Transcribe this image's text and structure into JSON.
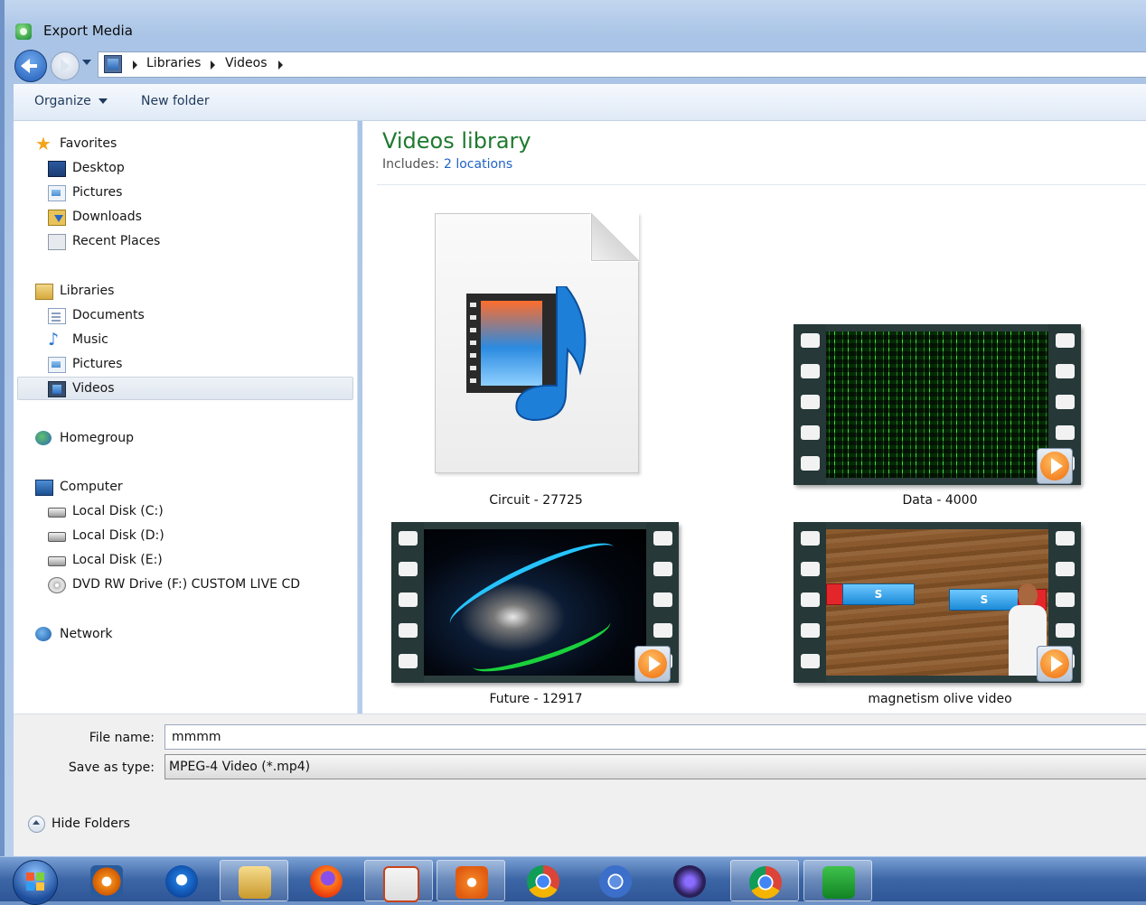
{
  "window": {
    "title": "Export Media"
  },
  "address": {
    "crumbs": [
      "Libraries",
      "Videos"
    ]
  },
  "toolbar": {
    "organize_label": "Organize",
    "new_folder_label": "New folder"
  },
  "nav": {
    "favorites": {
      "label": "Favorites",
      "items": [
        "Desktop",
        "Pictures",
        "Downloads",
        "Recent Places"
      ]
    },
    "libraries": {
      "label": "Libraries",
      "items": [
        "Documents",
        "Music",
        "Pictures",
        "Videos"
      ],
      "selected": "Videos"
    },
    "homegroup": {
      "label": "Homegroup"
    },
    "computer": {
      "label": "Computer",
      "items": [
        "Local Disk (C:)",
        "Local Disk (D:)",
        "Local Disk (E:)",
        "DVD RW Drive (F:) CUSTOM LIVE CD"
      ]
    },
    "network": {
      "label": "Network"
    }
  },
  "library": {
    "title": "Videos library",
    "includes_label": "Includes:",
    "locations_link": "2 locations"
  },
  "files": [
    {
      "name": "Circuit - 27725",
      "kind": "generic-media-icon"
    },
    {
      "name": "Data - 4000",
      "kind": "video-thumbnail-matrix"
    },
    {
      "name": "Future - 12917",
      "kind": "video-thumbnail-abstract"
    },
    {
      "name": "magnetism olive video",
      "kind": "video-thumbnail-magnets"
    }
  ],
  "magnet_labels": [
    "S",
    "S"
  ],
  "save": {
    "filename_label": "File name:",
    "filename_value": "mmmm",
    "type_label": "Save as type:",
    "type_value": "MPEG-4 Video (*.mp4)"
  },
  "hide_folders_label": "Hide Folders",
  "taskbar": {
    "apps": [
      "media-player-icon",
      "internet-explorer-icon",
      "file-explorer-icon",
      "firefox-icon",
      "powerpoint-icon",
      "screen-capture-icon",
      "chrome-icon",
      "chromium-icon",
      "video-editor-icon",
      "chrome-profile-icon",
      "camtasia-icon"
    ]
  },
  "colors": {
    "library_title": "#1e7a2e",
    "link": "#1f63c4",
    "play_button": "#f06c0b"
  }
}
